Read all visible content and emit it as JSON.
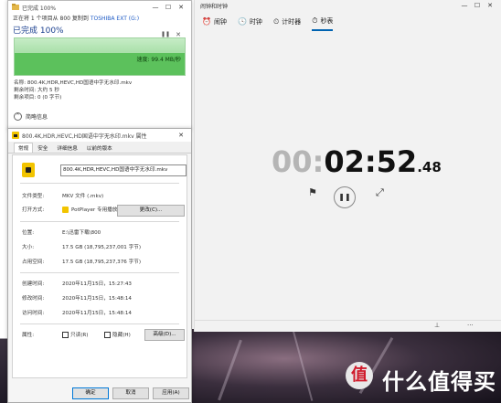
{
  "copy": {
    "title": "已完成 100%",
    "line1_prefix": "正在将 1 个项目从 800 复制到 ",
    "line1_dest": "TOSHIBA EXT (G:)",
    "status": "已完成 100%",
    "progress": 1.0,
    "speed": "速度: 99.4 MB/秒",
    "name_label": "名称: 800.4K,HDR,HEVC,HD国语中字无水印.mkv",
    "time_left": "剩余时间: 大约 5 秒",
    "items_left": "剩余项目: 0 (0 字节)",
    "less_info": "简略信息",
    "pause_icon": "pause-icon",
    "close_icon": "close-icon"
  },
  "props": {
    "title": "800.4K,HDR,HEVC,HD国语中字无水印.mkv 属性",
    "tabs": [
      "常规",
      "安全",
      "详细信息",
      "以前的版本"
    ],
    "filename": "800.4K,HDR,HEVC,HD国语中字无水印.mkv",
    "type_label": "文件类型:",
    "type_value": "MKV 文件 (.mkv)",
    "open_label": "打开方式:",
    "open_value": "PotPlayer 专用播放 (64",
    "change_btn": "更改(C)...",
    "location_label": "位置:",
    "location_value": "E:\\迅雷下载\\800",
    "size_label": "大小:",
    "size_value": "17.5 GB (18,795,237,001 字节)",
    "disk_label": "占用空间:",
    "disk_value": "17.5 GB (18,795,237,376 字节)",
    "created_label": "创建时间:",
    "created_value": "2020年11月15日，15:27:43",
    "modified_label": "修改时间:",
    "modified_value": "2020年11月15日，15:48:14",
    "accessed_label": "访问时间:",
    "accessed_value": "2020年11月15日，15:48:14",
    "attr_label": "属性:",
    "readonly_label": "只读(R)",
    "hidden_label": "隐藏(H)",
    "advanced_btn": "高级(D)...",
    "ok_btn": "确定",
    "cancel_btn": "取消",
    "apply_btn": "应用(A)"
  },
  "clock": {
    "title": "闹钟和时钟",
    "tabs": [
      {
        "icon": "alarm-icon",
        "label": "闹钟"
      },
      {
        "icon": "clock-icon",
        "label": "时钟"
      },
      {
        "icon": "timer-icon",
        "label": "计时器"
      },
      {
        "icon": "stopwatch-icon",
        "label": "秒表"
      }
    ],
    "time_hours": "00",
    "time_mmss": "02:52",
    "time_cs": ".48",
    "flag_icon": "flag-icon",
    "pause_icon": "pause-icon",
    "expand_icon": "expand-icon"
  },
  "watermark": {
    "logo": "值",
    "text": "什么值得买"
  },
  "colors": {
    "accent": "#0063b1",
    "progress_green": "#5cc15c"
  }
}
